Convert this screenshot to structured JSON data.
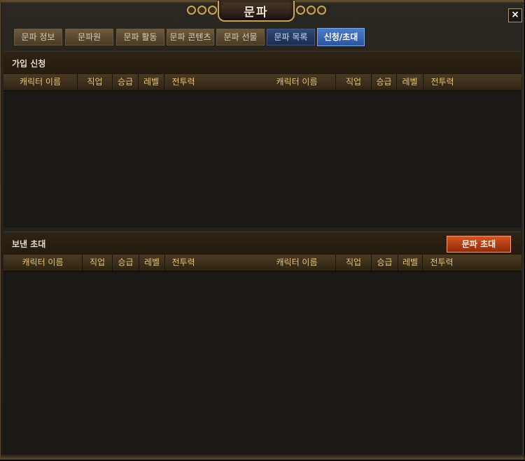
{
  "window": {
    "title": "문파",
    "close_label": "×"
  },
  "tabs": [
    {
      "label": "문파 정보",
      "style": "brown"
    },
    {
      "label": "문파원",
      "style": "brown"
    },
    {
      "label": "문파 활동",
      "style": "brown"
    },
    {
      "label": "문파 콘텐츠",
      "style": "brown"
    },
    {
      "label": "문파 선물",
      "style": "brown"
    },
    {
      "label": "문파 목록",
      "style": "blue"
    },
    {
      "label": "신청/초대",
      "style": "active"
    }
  ],
  "join_requests": {
    "title": "가입 신청",
    "columns_left": [
      "캐릭터 이름",
      "직업",
      "승급",
      "레벨",
      "전투력"
    ],
    "columns_right": [
      "캐릭터 이름",
      "직업",
      "승급",
      "레벨",
      "전투력"
    ],
    "rows": []
  },
  "sent_invites": {
    "title": "보낸 초대",
    "invite_button": "문파 초대",
    "columns_left": [
      "캐릭터 이름",
      "직업",
      "승급",
      "레벨",
      "전투력"
    ],
    "columns_right": [
      "캐릭터 이름",
      "직업",
      "승급",
      "레벨",
      "전투력"
    ],
    "rows": []
  },
  "colors": {
    "active_tab": "#2b55a0",
    "column_text": "#e8c276",
    "invite_button": "#d5541e"
  }
}
